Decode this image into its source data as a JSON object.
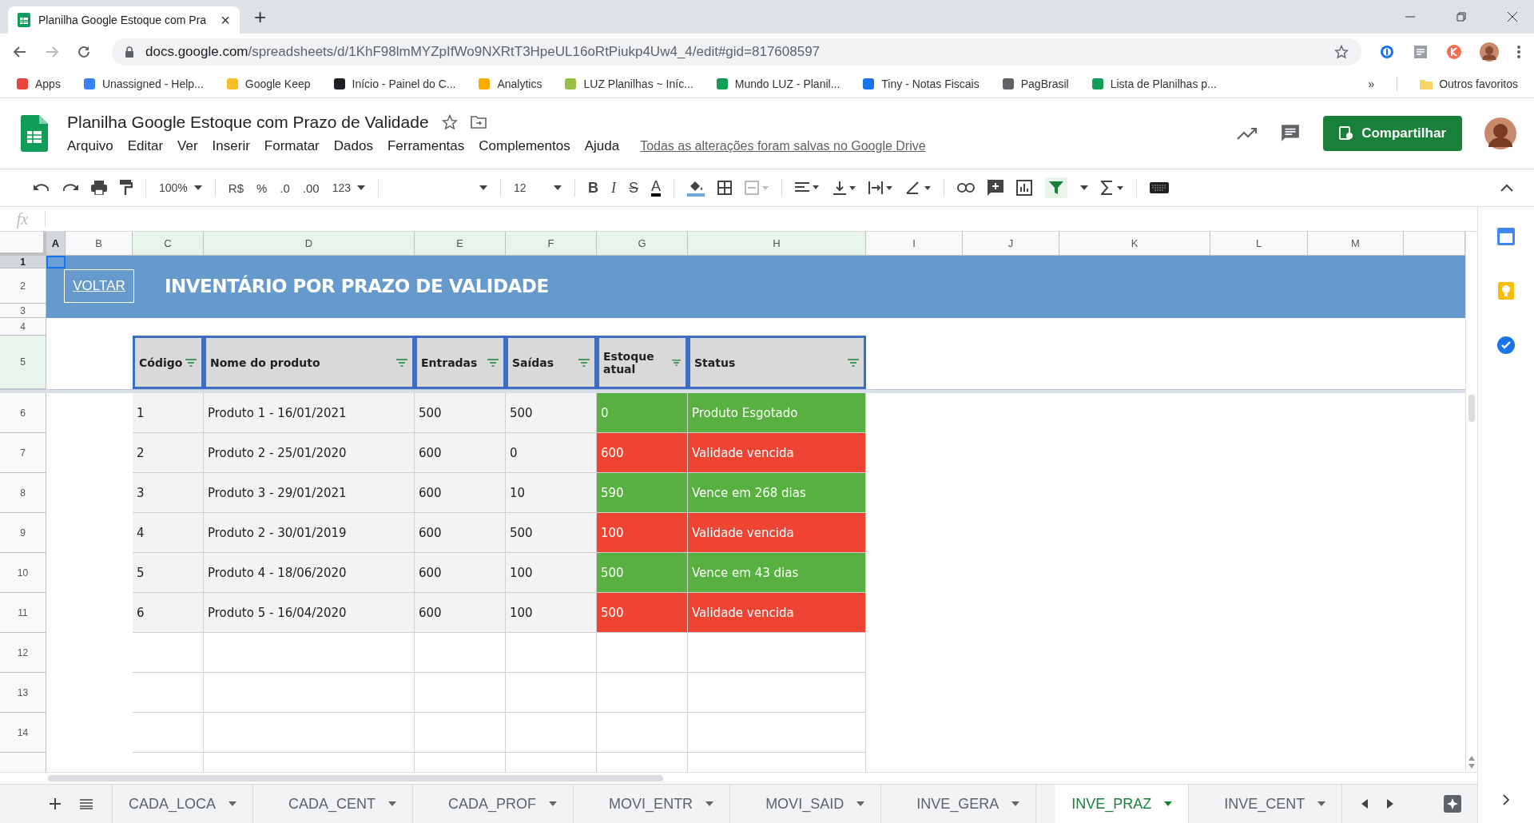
{
  "browser": {
    "tab_title": "Planilha Google Estoque com Pra",
    "tab_close": "×",
    "new_tab": "+",
    "url_host": "docs.google.com",
    "url_path": "/spreadsheets/d/1KhF98lmMYZpIfWo9NXRtT3HpeUL16oRtPiukp4Uw4_4/edit#gid=817608597",
    "bookmarks": [
      {
        "label": "Apps",
        "color": "#e8453c"
      },
      {
        "label": "Unassigned - Help...",
        "color": "#3b82f6"
      },
      {
        "label": "Google Keep",
        "color": "#f6bf26"
      },
      {
        "label": "Início - Painel do C...",
        "color": "#202124"
      },
      {
        "label": "Analytics",
        "color": "#f9ab00"
      },
      {
        "label": "LUZ Planilhas ~ Iníc...",
        "color": "#95bf47"
      },
      {
        "label": "Mundo LUZ - Planil...",
        "color": "#0f9d58"
      },
      {
        "label": "Tiny - Notas Fiscais",
        "color": "#1a73e8"
      },
      {
        "label": "PagBrasil",
        "color": "#5f6368"
      },
      {
        "label": "Lista de Planilhas p...",
        "color": "#0f9d58"
      }
    ],
    "more": "»",
    "other_bookmarks": "Outros favoritos"
  },
  "doc": {
    "title": "Planilha Google Estoque com Prazo de Validade",
    "menus": [
      "Arquivo",
      "Editar",
      "Ver",
      "Inserir",
      "Formatar",
      "Dados",
      "Ferramentas",
      "Complementos",
      "Ajuda"
    ],
    "save_status": "Todas as alterações foram salvas no Google Drive",
    "share": "Compartilhar"
  },
  "toolbar": {
    "zoom": "100%",
    "currency": "R$",
    "percent": "%",
    "decrease_decimals": ".0",
    "increase_decimals": ".00",
    "number_format": "123",
    "font_size": "12",
    "bold": "B",
    "italic": "I",
    "strike": "S",
    "text_color": "A",
    "filter_on": true
  },
  "formula_bar": {
    "label": "fx"
  },
  "sheet": {
    "columns": [
      {
        "label": "A",
        "selected": true,
        "highlighted": false
      },
      {
        "label": "B",
        "selected": false,
        "highlighted": false
      },
      {
        "label": "C",
        "selected": false,
        "highlighted": true
      },
      {
        "label": "D",
        "selected": false,
        "highlighted": true
      },
      {
        "label": "E",
        "selected": false,
        "highlighted": true
      },
      {
        "label": "F",
        "selected": false,
        "highlighted": true
      },
      {
        "label": "G",
        "selected": false,
        "highlighted": true
      },
      {
        "label": "H",
        "selected": false,
        "highlighted": true
      },
      {
        "label": "I",
        "selected": false,
        "highlighted": false
      },
      {
        "label": "J",
        "selected": false,
        "highlighted": false
      },
      {
        "label": "K",
        "selected": false,
        "highlighted": false
      },
      {
        "label": "L",
        "selected": false,
        "highlighted": false
      },
      {
        "label": "M",
        "selected": false,
        "highlighted": false
      }
    ],
    "row_numbers": [
      {
        "label": "1",
        "selected": true,
        "highlighted": false
      },
      {
        "label": "2",
        "selected": false,
        "highlighted": false
      },
      {
        "label": "3",
        "selected": false,
        "highlighted": false
      },
      {
        "label": "4",
        "selected": false,
        "highlighted": false
      },
      {
        "label": "5",
        "selected": false,
        "highlighted": true
      },
      {
        "label": "6",
        "selected": false,
        "highlighted": false
      },
      {
        "label": "7",
        "selected": false,
        "highlighted": false
      },
      {
        "label": "8",
        "selected": false,
        "highlighted": false
      },
      {
        "label": "9",
        "selected": false,
        "highlighted": false
      },
      {
        "label": "10",
        "selected": false,
        "highlighted": false
      },
      {
        "label": "11",
        "selected": false,
        "highlighted": false
      },
      {
        "label": "12",
        "selected": false,
        "highlighted": false
      },
      {
        "label": "13",
        "selected": false,
        "highlighted": false
      },
      {
        "label": "14",
        "selected": false,
        "highlighted": false
      }
    ],
    "back_link": "VOLTAR",
    "banner_title": "INVENTÁRIO POR PRAZO DE VALIDADE",
    "table": {
      "headers": [
        "Código",
        "Nome do produto",
        "Entradas",
        "Saídas",
        "Estoque atual",
        "Status"
      ],
      "rows": [
        {
          "code": "1",
          "name": "Produto 1 - 16/01/2021",
          "entradas": "500",
          "saidas": "500",
          "estoque": "0",
          "status": "Produto Esgotado",
          "color": "#57b03f"
        },
        {
          "code": "2",
          "name": "Produto 2 - 25/01/2020",
          "entradas": "600",
          "saidas": "0",
          "estoque": "600",
          "status": "Validade vencida",
          "color": "#ee4431"
        },
        {
          "code": "3",
          "name": "Produto 3 - 29/01/2021",
          "entradas": "600",
          "saidas": "10",
          "estoque": "590",
          "status": "Vence em 268 dias",
          "color": "#57b03f"
        },
        {
          "code": "4",
          "name": "Produto 2 - 30/01/2019",
          "entradas": "600",
          "saidas": "500",
          "estoque": "100",
          "status": "Validade vencida",
          "color": "#ee4431"
        },
        {
          "code": "5",
          "name": "Produto 4 - 18/06/2020",
          "entradas": "600",
          "saidas": "100",
          "estoque": "500",
          "status": "Vence em 43 dias",
          "color": "#57b03f"
        },
        {
          "code": "6",
          "name": "Produto 5 - 16/04/2020",
          "entradas": "600",
          "saidas": "100",
          "estoque": "500",
          "status": "Validade vencida",
          "color": "#ee4431"
        }
      ]
    }
  },
  "sheet_tabs": [
    {
      "label": "CADA_LOCA",
      "selected": false
    },
    {
      "label": "CADA_CENT",
      "selected": false
    },
    {
      "label": "CADA_PROF",
      "selected": false
    },
    {
      "label": "MOVI_ENTR",
      "selected": false
    },
    {
      "label": "MOVI_SAID",
      "selected": false
    },
    {
      "label": "INVE_GERA",
      "selected": false
    },
    {
      "label": "INVE_PRAZ",
      "selected": true
    },
    {
      "label": "INVE_CENT",
      "selected": false
    }
  ]
}
